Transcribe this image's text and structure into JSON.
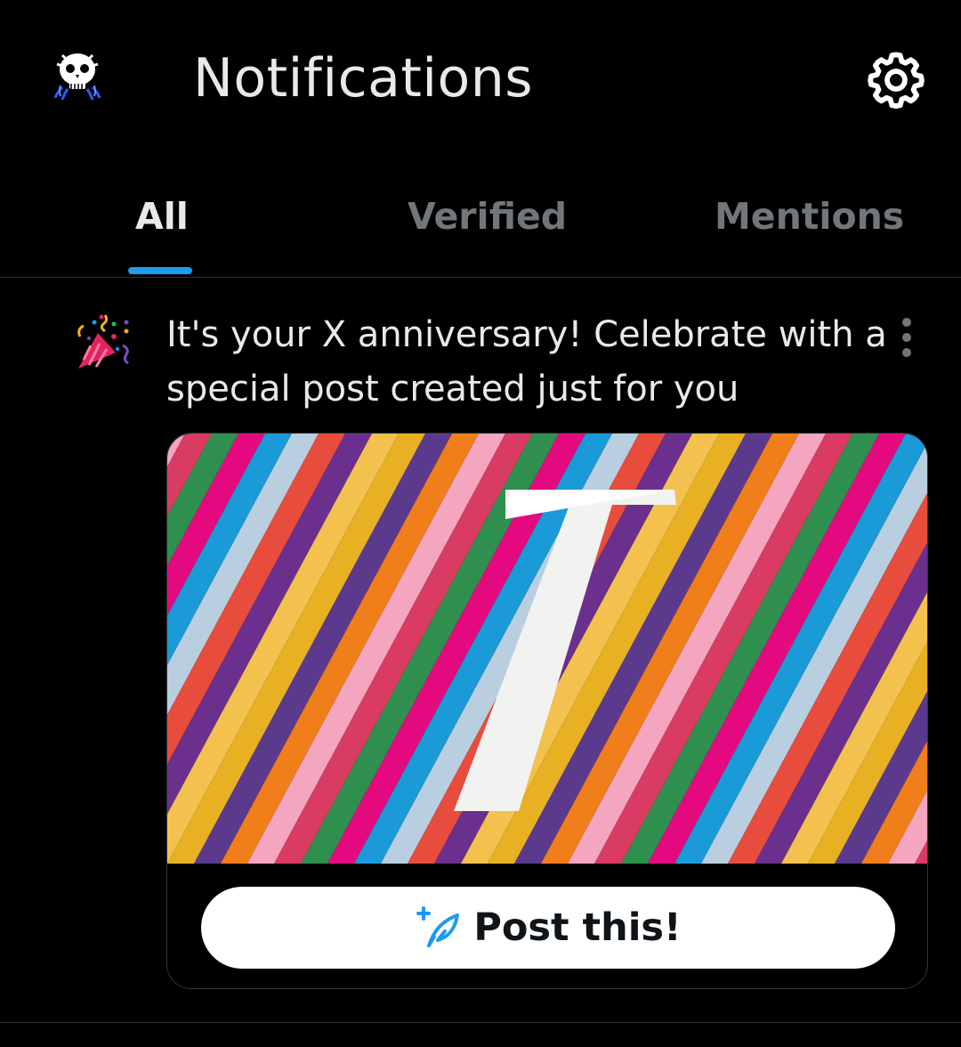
{
  "header": {
    "title": "Notifications",
    "avatar_icon": "skull-avatar",
    "settings_icon": "gear-icon"
  },
  "tabs": [
    {
      "label": "All",
      "active": true
    },
    {
      "label": "Verified",
      "active": false
    },
    {
      "label": "Mentions",
      "active": false
    }
  ],
  "notification": {
    "icon": "party-popper-icon",
    "text": "It's your X anniversary! Celebrate with a special post created just for you",
    "card": {
      "image_number": "7",
      "button_label": "Post this!",
      "button_icon": "sparkle-feather-icon"
    }
  },
  "colors": {
    "background": "#000000",
    "accent": "#1d9bf0",
    "text_primary": "#e7e9ea",
    "text_secondary": "#71767b",
    "divider": "#2f3336"
  }
}
